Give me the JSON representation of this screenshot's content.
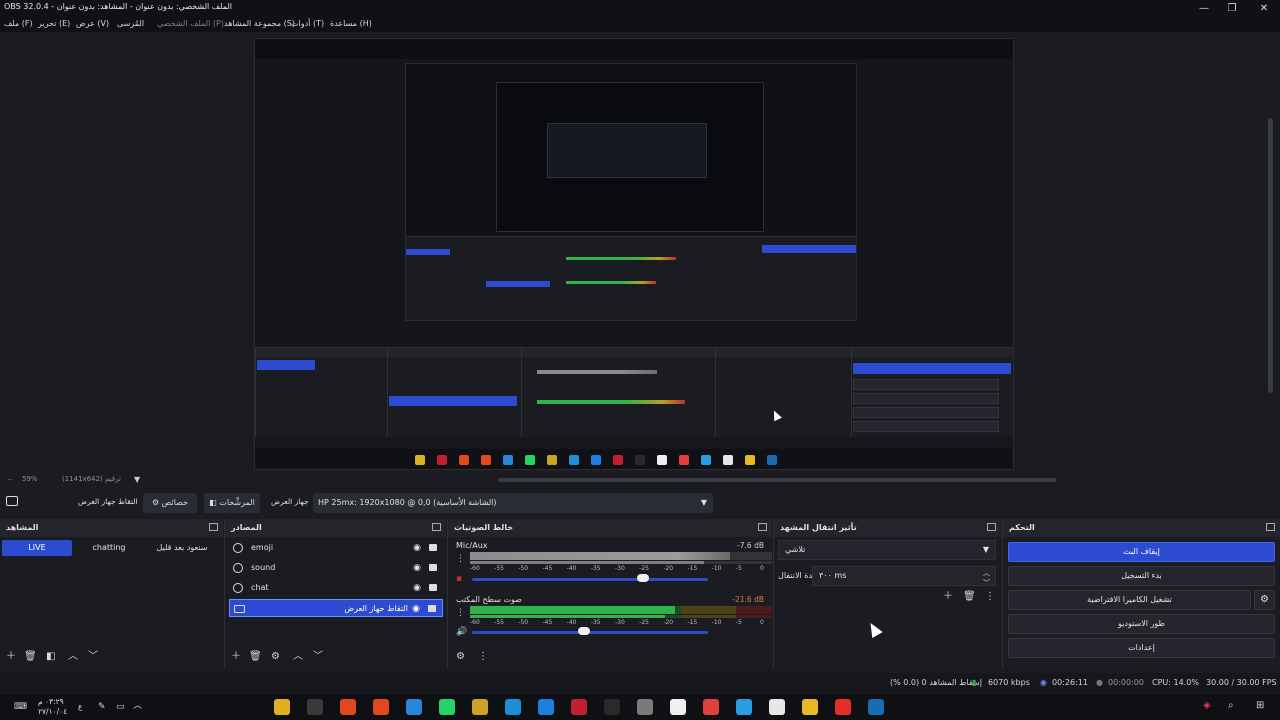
{
  "window": {
    "title": "OBS 32.0.4 - الملف الشخصي: بدون عنوان - المشاهد: بدون عنوان",
    "controls": {
      "minimize": "—",
      "restore": "❐",
      "close": "✕"
    }
  },
  "menu": [
    {
      "label": "ملف (F)"
    },
    {
      "label": "تحرير (E)"
    },
    {
      "label": "عرض (V)"
    },
    {
      "label": "المُرسى"
    },
    {
      "label": "الملف الشخصي (P)"
    },
    {
      "label": "مجموعة المشاهد (S)"
    },
    {
      "label": "أدوات (T)"
    },
    {
      "label": "مساعدة (H)"
    }
  ],
  "zoom": {
    "level": "59%",
    "resolution": "(1141x642) ترقيم"
  },
  "source_toolbar": {
    "capture_label": "التقاط جهاز العرض",
    "properties_label": "خصائص",
    "filters_label": "المرشِّحات",
    "display_label": "جهاز العرض",
    "display_value": "HP 25mx: 1920x1080 @ 0,0 (الشاشة الأساسية)"
  },
  "scenes": {
    "title": "المشاهد",
    "items": [
      {
        "label": "LIVE",
        "active": true
      },
      {
        "label": "chatting",
        "active": false
      },
      {
        "label": "سنعود بعد قليل",
        "active": false
      }
    ]
  },
  "sources": {
    "title": "المصادر",
    "items": [
      {
        "name": "emoji",
        "icon": "globe-icon",
        "selected": false
      },
      {
        "name": "sound",
        "icon": "globe-icon",
        "selected": false
      },
      {
        "name": "chat",
        "icon": "globe-icon",
        "selected": false
      },
      {
        "name": "التقاط جهاز العرض",
        "icon": "monitor-icon",
        "selected": true
      }
    ]
  },
  "mixer": {
    "title": "خالط الصوتيات",
    "channels": [
      {
        "name": "Mic/Aux",
        "db": "-7.6 dB",
        "level": 0.86,
        "fader": 0.7,
        "muted": false
      },
      {
        "name": "صوت سطح المكتب",
        "db": "-21.6 dB",
        "level": 0.68,
        "fader": 0.45,
        "muted": false
      }
    ],
    "ticks": [
      "-60",
      "-55",
      "-50",
      "-45",
      "-40",
      "-35",
      "-30",
      "-25",
      "-20",
      "-15",
      "-10",
      "-5",
      "0"
    ]
  },
  "transitions": {
    "title": "تأثير انتقال المشهد",
    "selected": "تلاشي",
    "duration_label": "مدة الانتقال",
    "duration_value": "٣٠٠ ms"
  },
  "controls": {
    "title": "التحكم",
    "buttons": [
      {
        "label": "إيقاف البث",
        "primary": true
      },
      {
        "label": "بدء التسجيل",
        "primary": false
      },
      {
        "label": "تشغيل الكاميرا الافتراضية",
        "primary": false
      },
      {
        "label": "طور الاستوديو",
        "primary": false
      },
      {
        "label": "إعدادات",
        "primary": false
      }
    ]
  },
  "status": {
    "dropped": "إسقاط المشاهد 0 (0.0 %)",
    "bitrate": "6070 kbps",
    "live_time": "00:26:11",
    "rec_time": "00:00:00",
    "cpu": "CPU: 14.0%",
    "fps": "30.00 / 30.00 FPS"
  },
  "taskbar": {
    "time": "٠٣:٢٩ م",
    "date": "٢٧/١٠/٠٤",
    "lang": "ع",
    "apps": [
      {
        "icon": "chrome-icon",
        "color": "#e0b020"
      },
      {
        "icon": "obs-icon",
        "color": "#3a3a3a"
      },
      {
        "icon": "brave-icon",
        "color": "#e2481f"
      },
      {
        "icon": "brave-icon",
        "color": "#e2481f"
      },
      {
        "icon": "vscode-icon",
        "color": "#2b86d8"
      },
      {
        "icon": "whatsapp-icon",
        "color": "#25d366"
      },
      {
        "icon": "app-icon",
        "color": "#caa324"
      },
      {
        "icon": "edge-icon",
        "color": "#1e8fd6"
      },
      {
        "icon": "skype-icon",
        "color": "#1f7ee0"
      },
      {
        "icon": "video-editor-icon",
        "color": "#c0202d"
      },
      {
        "icon": "terminal-icon",
        "color": "#2a2a2a"
      },
      {
        "icon": "app-icon",
        "color": "#7a7a7a"
      },
      {
        "icon": "capcut-icon",
        "color": "#f0f0f0"
      },
      {
        "icon": "chrome-icon",
        "color": "#e04040"
      },
      {
        "icon": "telegram-icon",
        "color": "#2a9ee0"
      },
      {
        "icon": "store-icon",
        "color": "#e7e7e7"
      },
      {
        "icon": "folder-icon",
        "color": "#e8b923"
      },
      {
        "icon": "youtube-icon",
        "color": "#e52d27"
      },
      {
        "icon": "steam-icon",
        "color": "#1b6bb0"
      }
    ]
  }
}
